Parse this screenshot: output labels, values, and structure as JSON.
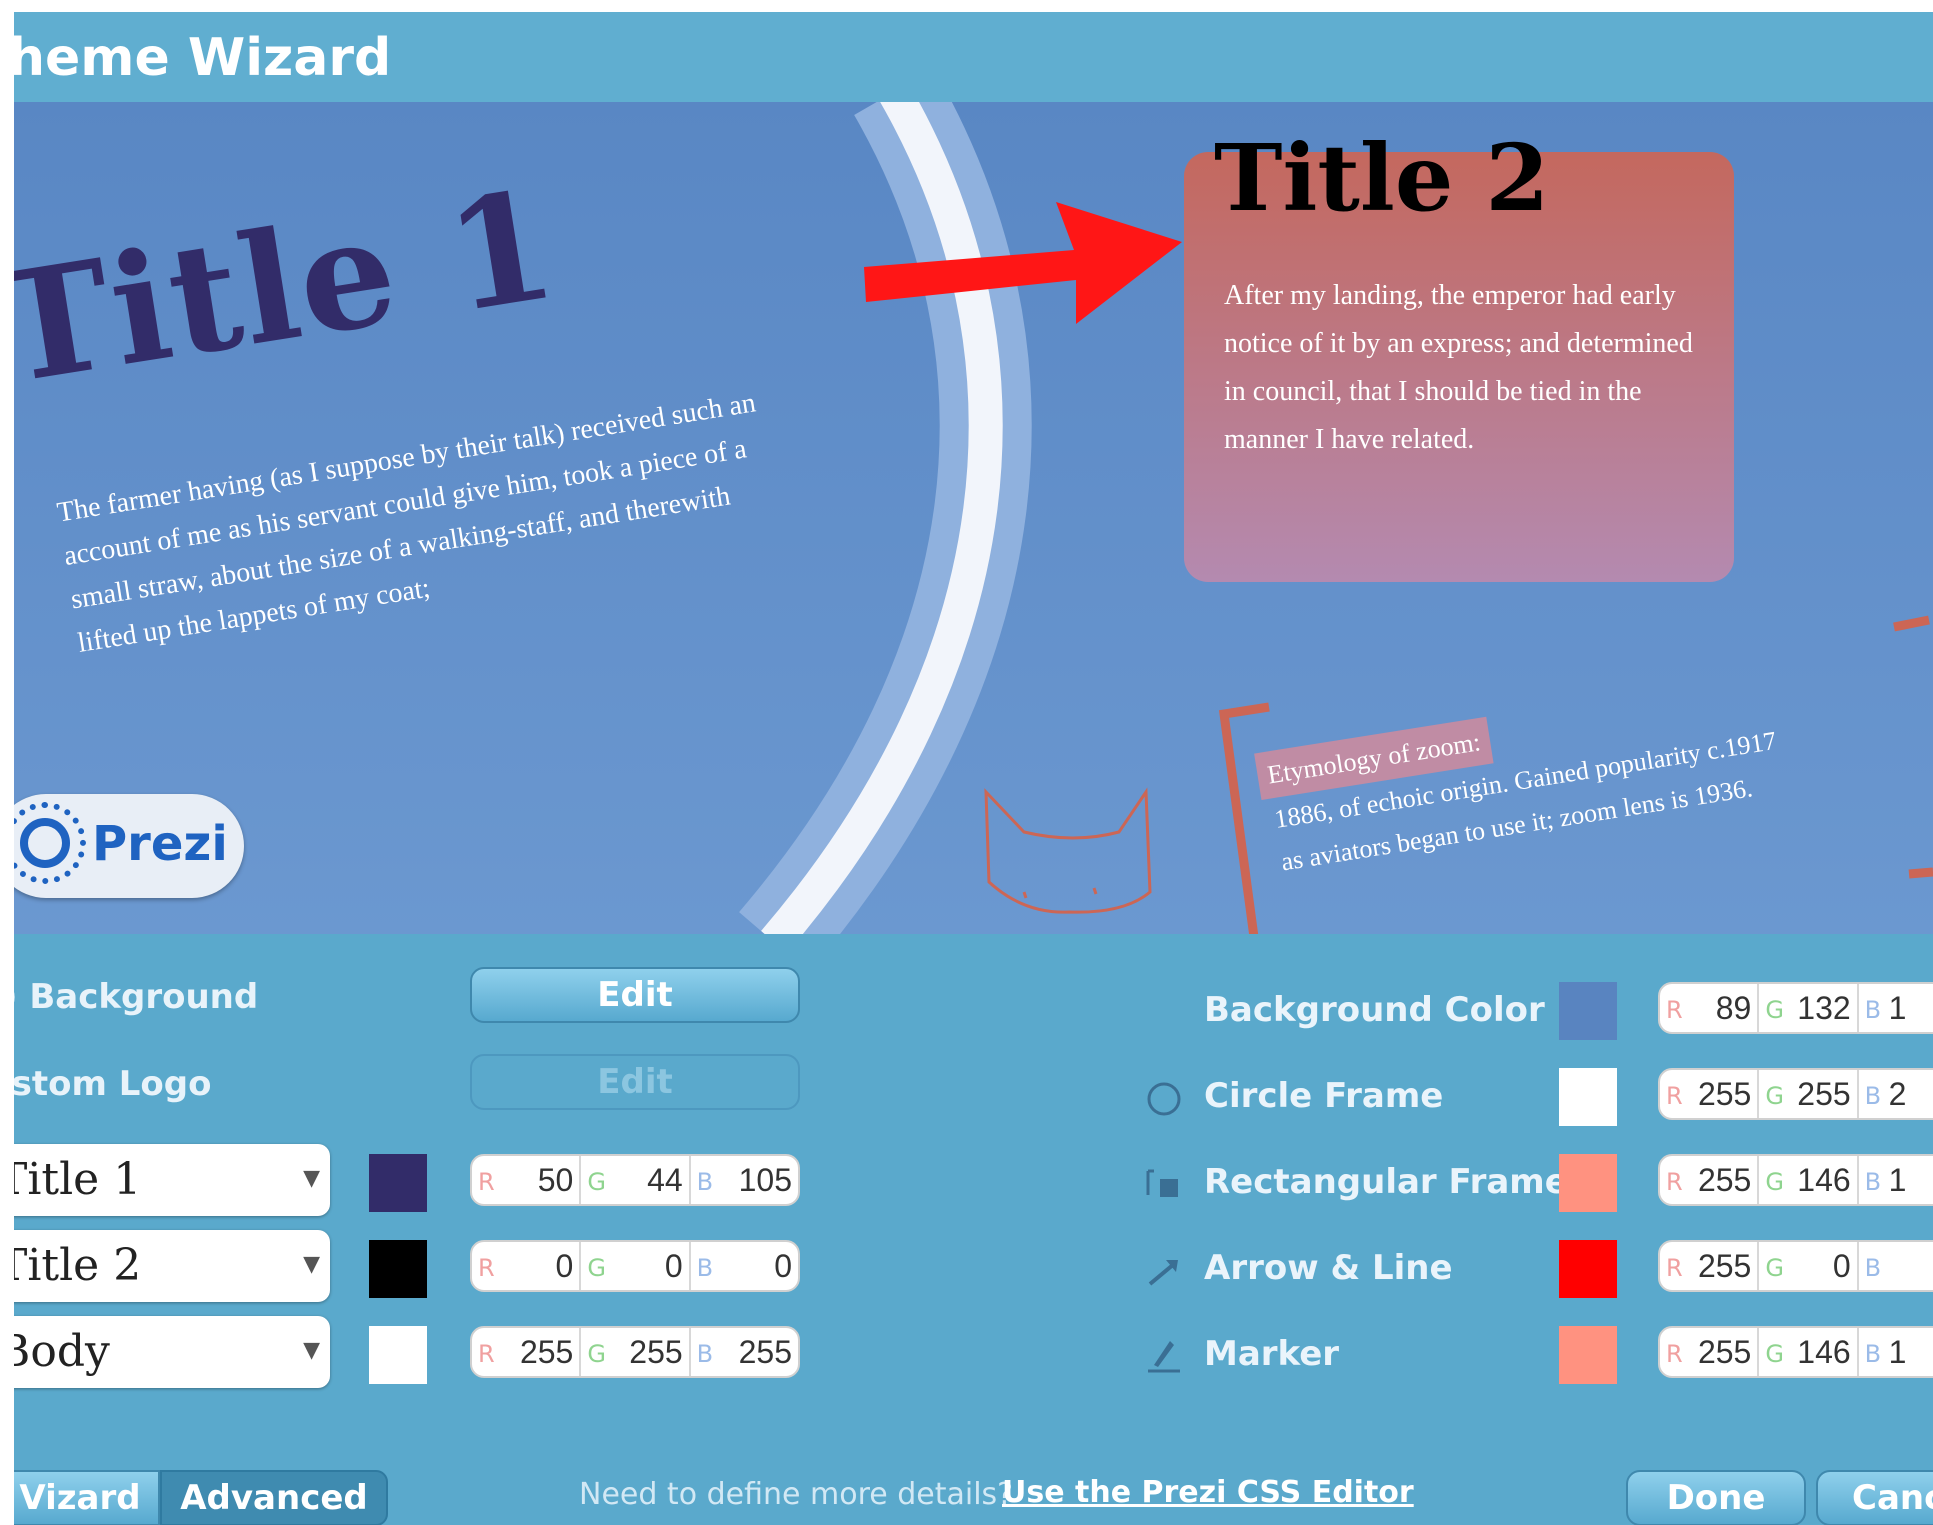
{
  "window": {
    "title": "heme Wizard"
  },
  "preview": {
    "title1": "Title 1",
    "body1": "The farmer having (as I suppose by their talk) received such an account of me as his servant could give him, took a piece of a small straw, about the size of a walking-staff, and therewith lifted up the lappets of my coat;",
    "title2": "Title 2",
    "body2": "After my landing, the emperor had early notice of it by an express; and determined in council, that I should be tied in the manner I have related.",
    "etymology_head": "Etymology of zoom:",
    "etymology_body": "1886, of echoic origin. Gained popularity c.1917 as aviators began to use it; zoom lens is 1936.",
    "logo_text": "Prezi"
  },
  "left_panel": {
    "background_label": ") Background",
    "background_button": "Edit",
    "logo_label": "istom Logo",
    "logo_button": "Edit",
    "fonts": [
      {
        "selected": "Title 1",
        "color": "#322c69",
        "r": "50",
        "g": "44",
        "b": "105"
      },
      {
        "selected": "Title 2",
        "color": "#000000",
        "r": "0",
        "g": "0",
        "b": "0"
      },
      {
        "selected": "Body",
        "color": "#ffffff",
        "r": "255",
        "g": "255",
        "b": "255"
      }
    ],
    "rgb_labels": {
      "r": "R",
      "g": "G",
      "b": "B"
    }
  },
  "right_panel": {
    "rows": [
      {
        "label": "Background Color",
        "icon": "none",
        "color": "#5984c0",
        "r": "89",
        "g": "132",
        "b": "1"
      },
      {
        "label": "Circle Frame",
        "icon": "circle-frame-icon",
        "color": "#ffffff",
        "r": "255",
        "g": "255",
        "b": "2"
      },
      {
        "label": "Rectangular Frames",
        "icon": "rectangular-frames-icon",
        "color": "#ff9280",
        "r": "255",
        "g": "146",
        "b": "1"
      },
      {
        "label": "Arrow & Line",
        "icon": "arrow-line-icon",
        "color": "#ff0000",
        "r": "255",
        "g": "0",
        "b": ""
      },
      {
        "label": "Marker",
        "icon": "marker-icon",
        "color": "#ff9280",
        "r": "255",
        "g": "146",
        "b": "1"
      }
    ]
  },
  "footer": {
    "tab_wizard": "Vizard",
    "tab_advanced": "Advanced",
    "need_text": "Need to define more details?",
    "css_link": "Use the Prezi CSS Editor",
    "done": "Done",
    "cancel": "Canc"
  }
}
